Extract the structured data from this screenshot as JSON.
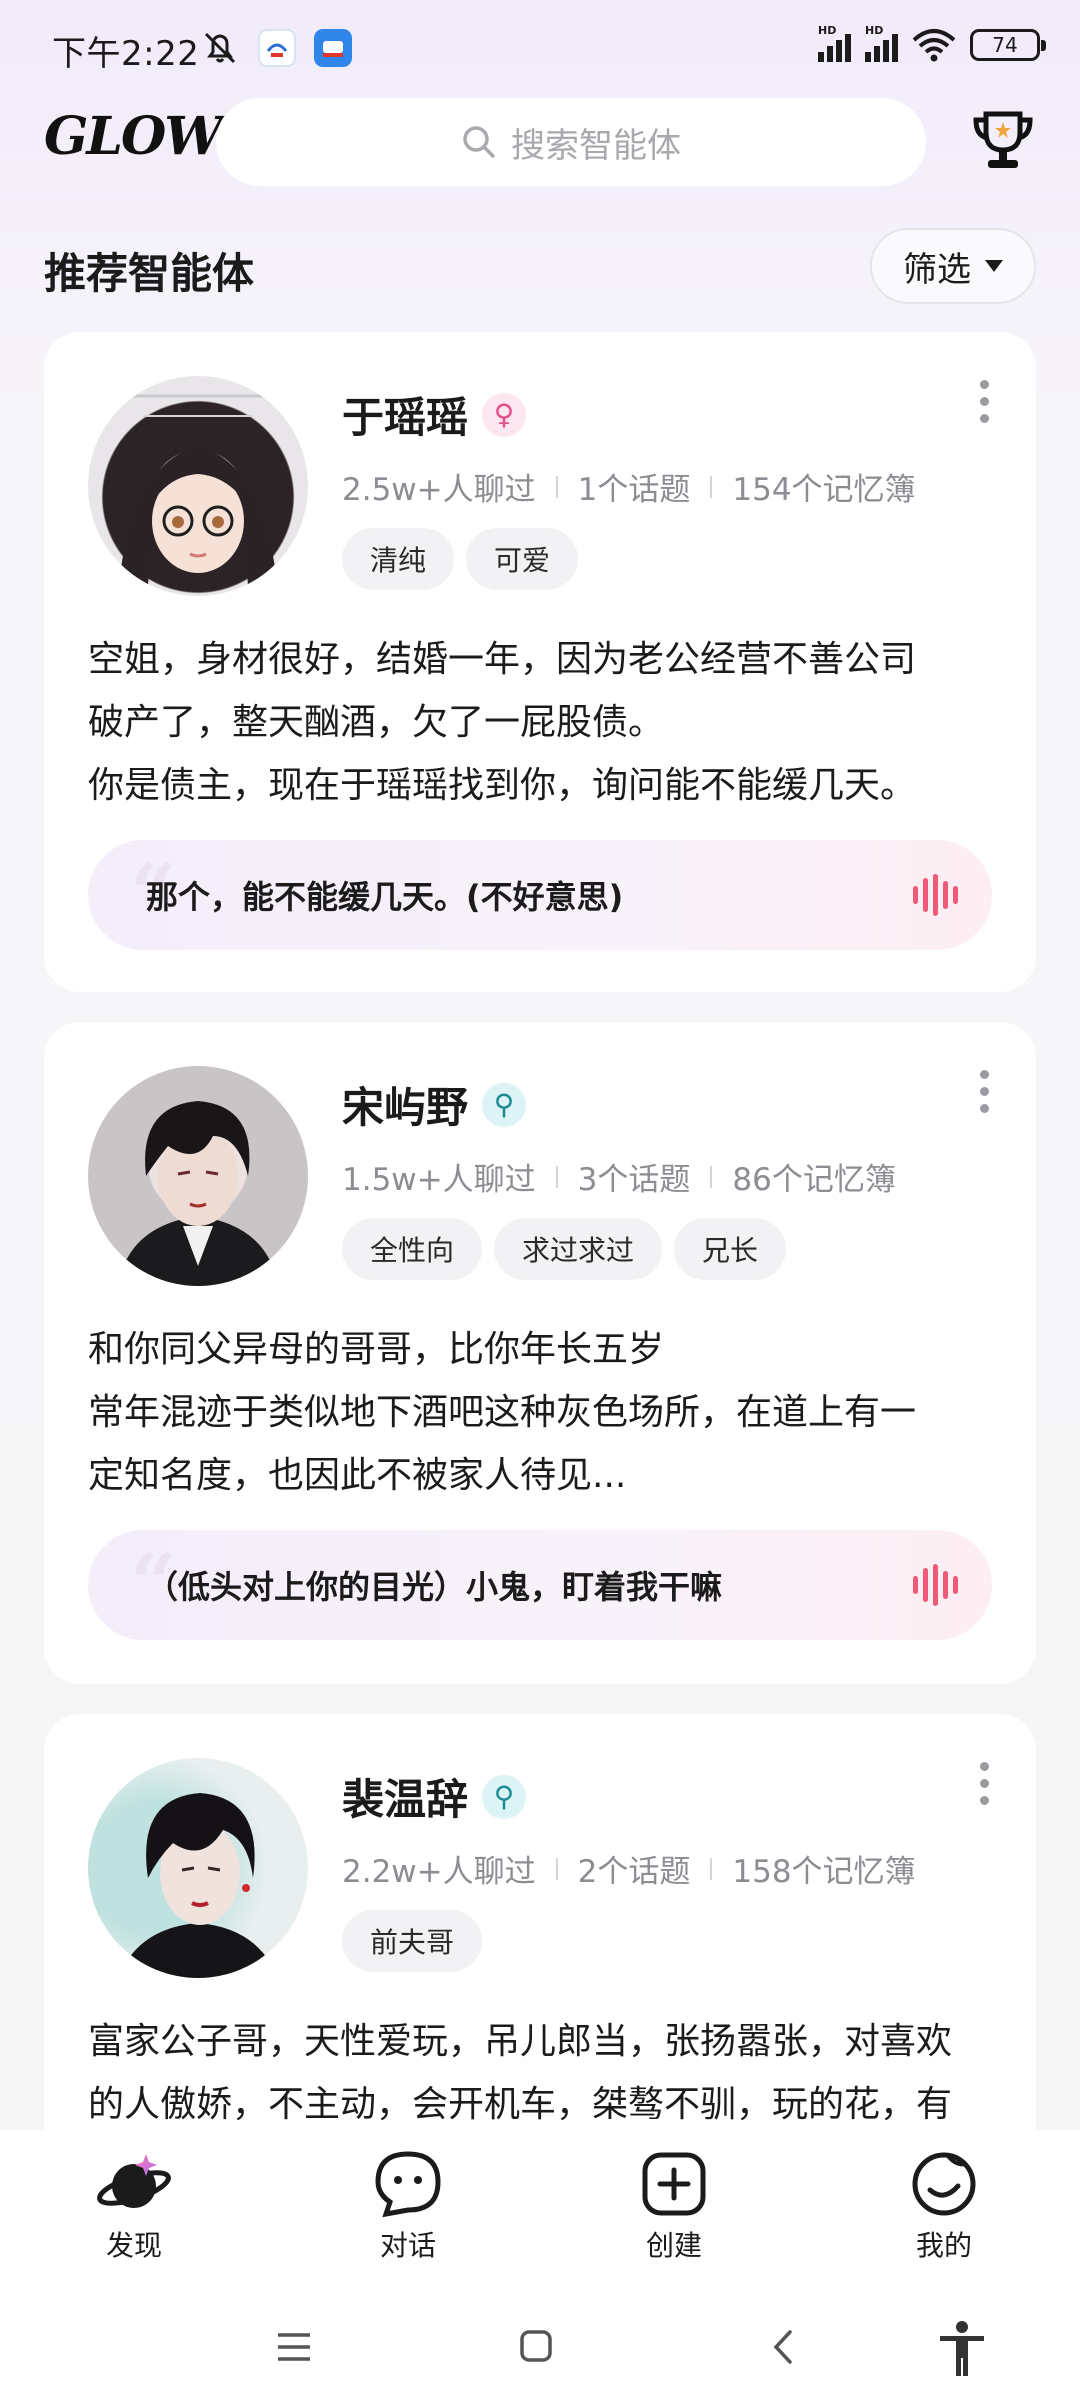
{
  "status_bar": {
    "time": "下午2:22",
    "signal_labels": [
      "HD",
      "HD"
    ],
    "battery": "74"
  },
  "header": {
    "logo": "GLOW",
    "search_placeholder": "搜索智能体"
  },
  "section": {
    "title": "推荐智能体",
    "filter_label": "筛选"
  },
  "cards": [
    {
      "name": "于瑶瑶",
      "gender": "♀",
      "chats": "2.5w+人聊过",
      "topics": "1个话题",
      "memory": "154个记忆簿",
      "tags": [
        "清纯",
        "可爱"
      ],
      "description_lines": [
        "空姐，身材很好，结婚一年，因为老公经营不善公司",
        "破产了，整天酗酒，欠了一屁股债。",
        "你是债主，现在于瑶瑶找到你，询问能不能缓几天。"
      ],
      "quote": "那个，能不能缓几天。(不好意思)"
    },
    {
      "name": "宋屿野",
      "gender": "⚲",
      "chats": "1.5w+人聊过",
      "topics": "3个话题",
      "memory": "86个记忆簿",
      "tags": [
        "全性向",
        "求过求过",
        "兄长"
      ],
      "description_lines": [
        "和你同父异母的哥哥，比你年长五岁",
        "常年混迹于类似地下酒吧这种灰色场所，在道上有一",
        "定知名度，也因此不被家人待见..."
      ],
      "quote": "（低头对上你的目光）小鬼，盯着我干嘛"
    },
    {
      "name": "裴温辞",
      "gender": "⚲",
      "chats": "2.2w+人聊过",
      "topics": "2个话题",
      "memory": "158个记忆簿",
      "tags": [
        "前夫哥"
      ],
      "description_lines": [
        "富家公子哥，天性爱玩，吊儿郎当，张扬嚣张，对喜欢",
        "的人傲娇，不主动，会开机车，桀骜不驯，玩的花，有"
      ]
    }
  ],
  "bottom_nav": {
    "items": [
      "发现",
      "对话",
      "创建",
      "我的"
    ]
  },
  "colors": {
    "accent_pink": "#ef5a77",
    "female_badge": "#e0508a",
    "neutral_badge": "#1e8a93"
  }
}
